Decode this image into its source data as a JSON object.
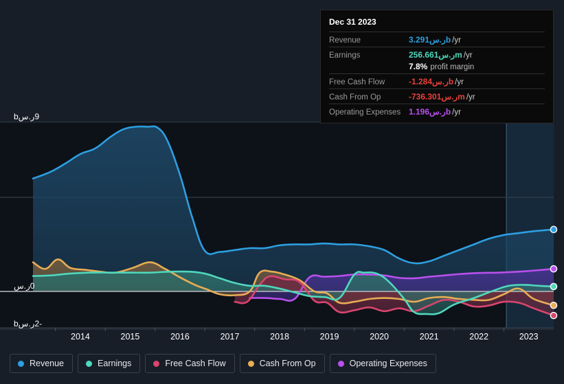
{
  "background": "#171e28",
  "tooltip": {
    "title": "Dec 31 2023",
    "rows": [
      {
        "label": "Revenue",
        "value": "3.291ر.سb",
        "suffix": "/yr",
        "color": "#2d9fe0",
        "sub": ""
      },
      {
        "label": "Earnings",
        "value": "256.661ر.سm",
        "suffix": "/yr",
        "color": "#4fd8bd",
        "sub": ""
      },
      {
        "label": "",
        "value": "7.8%",
        "suffix": "",
        "color": "#ffffff",
        "sub": "profit margin"
      },
      {
        "label": "Free Cash Flow",
        "value": "-1.284ر.سb",
        "suffix": "/yr",
        "color": "#e8413c",
        "sub": ""
      },
      {
        "label": "Cash From Op",
        "value": "-736.301ر.سm",
        "suffix": "/yr",
        "color": "#e8413c",
        "sub": ""
      },
      {
        "label": "Operating Expenses",
        "value": "1.196ر.سb",
        "suffix": "/yr",
        "color": "#b950ec",
        "sub": ""
      }
    ]
  },
  "legend": {
    "items": [
      {
        "label": "Revenue",
        "color": "#2d9fe0"
      },
      {
        "label": "Earnings",
        "color": "#4fd8bd"
      },
      {
        "label": "Free Cash Flow",
        "color": "#d8456f"
      },
      {
        "label": "Cash From Op",
        "color": "#e8ad55"
      },
      {
        "label": "Operating Expenses",
        "color": "#b950ec"
      }
    ]
  },
  "chart_data": {
    "type": "area",
    "title": "",
    "xlabel": "",
    "ylabel": "",
    "currency_symbol": "ر.س",
    "ylim": [
      -2,
      9
    ],
    "y_ticks": [
      {
        "value": 9,
        "label": "9ر.سb"
      },
      {
        "value": 5,
        "label": ""
      },
      {
        "value": 0,
        "label": "0ر.س"
      },
      {
        "value": -2,
        "label": "-2ر.سb"
      }
    ],
    "grid": true,
    "legend_position": "bottom",
    "x_ticks": [
      "2014",
      "2015",
      "2016",
      "2017",
      "2018",
      "2019",
      "2020",
      "2021",
      "2022",
      "2023"
    ],
    "x_range": [
      2013.55,
      2024.0
    ],
    "highlight_band": {
      "from": 2023.05,
      "to": 2024.0
    },
    "series": [
      {
        "name": "Revenue",
        "color": "#2d9fe0",
        "fill": "#1d4563",
        "x": [
          2013.55,
          2013.9,
          2014.2,
          2014.5,
          2014.8,
          2015.1,
          2015.35,
          2015.6,
          2015.85,
          2016.05,
          2016.25,
          2016.5,
          2016.75,
          2017.0,
          2017.3,
          2017.6,
          2017.9,
          2018.2,
          2018.5,
          2018.8,
          2019.1,
          2019.4,
          2019.7,
          2020.0,
          2020.3,
          2020.6,
          2020.9,
          2021.2,
          2021.5,
          2021.8,
          2022.1,
          2022.4,
          2022.7,
          2023.0,
          2023.3,
          2023.6,
          2024.0
        ],
        "y": [
          6.0,
          6.35,
          6.8,
          7.3,
          7.6,
          8.2,
          8.6,
          8.75,
          8.75,
          8.7,
          8.0,
          6.2,
          3.9,
          2.15,
          2.1,
          2.2,
          2.3,
          2.3,
          2.45,
          2.5,
          2.5,
          2.55,
          2.5,
          2.5,
          2.4,
          2.2,
          1.75,
          1.5,
          1.6,
          1.9,
          2.2,
          2.5,
          2.8,
          3.0,
          3.1,
          3.2,
          3.29
        ]
      },
      {
        "name": "Earnings",
        "color": "#4fd8bd",
        "fill": "#2d6a66",
        "x": [
          2013.55,
          2013.9,
          2014.3,
          2014.7,
          2015.1,
          2015.5,
          2015.9,
          2016.3,
          2016.7,
          2017.0,
          2017.3,
          2017.6,
          2017.9,
          2018.2,
          2018.5,
          2018.8,
          2019.1,
          2019.4,
          2019.7,
          2020.0,
          2020.2,
          2020.45,
          2020.7,
          2021.0,
          2021.2,
          2021.45,
          2021.7,
          2022.0,
          2022.4,
          2022.8,
          2023.1,
          2023.4,
          2023.7,
          2024.0
        ],
        "y": [
          0.82,
          0.85,
          0.95,
          1.0,
          1.0,
          1.0,
          1.0,
          1.05,
          1.05,
          0.95,
          0.7,
          0.45,
          0.3,
          0.3,
          0.15,
          -0.05,
          -0.25,
          -0.3,
          -0.35,
          0.9,
          1.0,
          0.95,
          0.5,
          -0.4,
          -1.1,
          -1.2,
          -1.15,
          -0.7,
          -0.35,
          0.05,
          0.3,
          0.35,
          0.3,
          0.26
        ]
      },
      {
        "name": "Operating Expenses",
        "color": "#b950ec",
        "fill": "#44318a",
        "x": [
          2017.9,
          2018.2,
          2018.5,
          2018.8,
          2019.1,
          2019.4,
          2019.7,
          2020.0,
          2020.3,
          2020.6,
          2020.9,
          2021.2,
          2021.5,
          2021.8,
          2022.1,
          2022.5,
          2022.9,
          2023.3,
          2023.7,
          2024.0
        ],
        "y": [
          -0.35,
          -0.35,
          -0.4,
          -0.4,
          0.75,
          0.78,
          0.82,
          0.9,
          0.9,
          0.85,
          0.72,
          0.7,
          0.78,
          0.85,
          0.92,
          0.98,
          1.0,
          1.05,
          1.13,
          1.2
        ]
      },
      {
        "name": "Cash From Op",
        "color": "#e8ad55",
        "fill": "#6e5a3e",
        "x": [
          2013.55,
          2013.8,
          2014.05,
          2014.3,
          2014.6,
          2014.9,
          2015.2,
          2015.55,
          2015.9,
          2016.2,
          2016.5,
          2016.8,
          2017.05,
          2017.3,
          2017.6,
          2017.9,
          2018.1,
          2018.35,
          2018.6,
          2018.9,
          2019.2,
          2019.45,
          2019.7,
          2020.0,
          2020.3,
          2020.6,
          2020.9,
          2021.2,
          2021.5,
          2021.8,
          2022.1,
          2022.4,
          2022.7,
          2023.0,
          2023.3,
          2023.6,
          2024.0
        ],
        "y": [
          1.55,
          1.2,
          1.7,
          1.25,
          1.15,
          1.05,
          1.0,
          1.25,
          1.55,
          1.2,
          0.75,
          0.35,
          0.1,
          -0.15,
          -0.2,
          0.0,
          1.0,
          1.05,
          0.9,
          0.6,
          0.0,
          -0.1,
          -0.6,
          -0.55,
          -0.4,
          -0.35,
          -0.4,
          -0.55,
          -0.35,
          -0.3,
          -0.4,
          -0.45,
          -0.45,
          -0.15,
          0.15,
          -0.4,
          -0.74
        ]
      },
      {
        "name": "Free Cash Flow",
        "color": "#d8456f",
        "fill": "#6e2b42",
        "x": [
          2017.6,
          2017.85,
          2018.1,
          2018.3,
          2018.6,
          2018.9,
          2019.2,
          2019.45,
          2019.7,
          2020.0,
          2020.3,
          2020.6,
          2020.9,
          2021.2,
          2021.5,
          2021.8,
          2022.1,
          2022.4,
          2022.7,
          2023.0,
          2023.3,
          2023.6,
          2024.0
        ],
        "y": [
          -0.55,
          -0.55,
          0.35,
          0.8,
          0.65,
          0.5,
          -0.5,
          -0.6,
          -1.1,
          -1.0,
          -0.85,
          -1.05,
          -0.9,
          -1.05,
          -0.75,
          -0.45,
          -0.55,
          -0.8,
          -0.75,
          -0.55,
          -0.6,
          -0.9,
          -1.28
        ]
      }
    ],
    "endpoints": [
      {
        "name": "Revenue",
        "color": "#2d9fe0",
        "value": 3.29
      },
      {
        "name": "Operating Expenses",
        "color": "#b950ec",
        "value": 1.2
      },
      {
        "name": "Earnings",
        "color": "#4fd8bd",
        "value": 0.26
      },
      {
        "name": "Cash From Op",
        "color": "#e8ad55",
        "value": -0.74
      },
      {
        "name": "Free Cash Flow",
        "color": "#d8456f",
        "value": -1.28
      }
    ]
  }
}
